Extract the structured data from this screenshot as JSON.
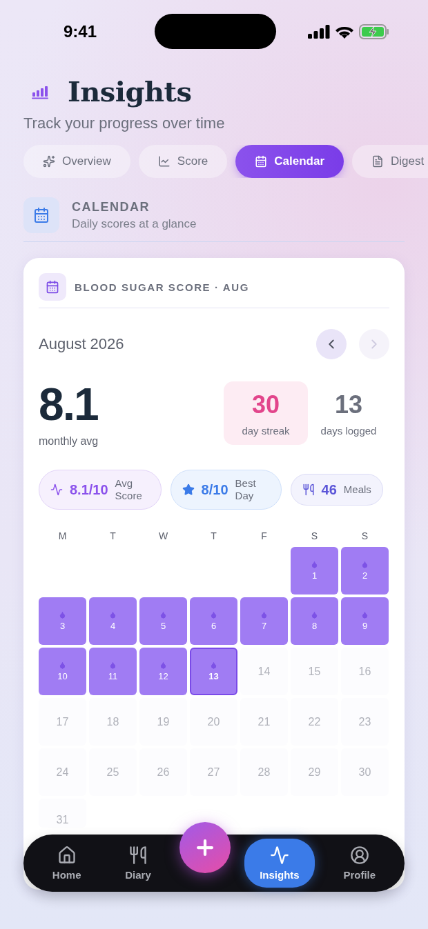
{
  "status_bar": {
    "time": "9:41"
  },
  "header": {
    "title": "Insights",
    "subtitle": "Track your progress over time"
  },
  "tabs": [
    {
      "label": "Overview",
      "selected": false
    },
    {
      "label": "Score",
      "selected": false
    },
    {
      "label": "Calendar",
      "selected": true
    },
    {
      "label": "Digest",
      "selected": false
    }
  ],
  "section": {
    "title": "CALENDAR",
    "subtitle": "Daily scores at a glance"
  },
  "card": {
    "title": "BLOOD SUGAR SCORE · AUG",
    "month": "August 2026",
    "prev_disabled": false,
    "next_disabled": true,
    "monthly_avg": {
      "value": "8.1",
      "label": "monthly avg"
    },
    "streak": {
      "value": "30",
      "label": "day streak"
    },
    "logged": {
      "value": "13",
      "label": "days logged"
    },
    "chips": [
      {
        "kind": "score",
        "value": "8.1/10",
        "label": "Avg Score"
      },
      {
        "kind": "best",
        "value": "8/10",
        "label": "Best Day"
      },
      {
        "kind": "meals",
        "value": "46",
        "label": "Meals"
      }
    ],
    "weekdays": [
      "M",
      "T",
      "W",
      "T",
      "F",
      "S",
      "S"
    ],
    "weeks": [
      [
        {
          "day": "1",
          "logged": true,
          "today": false
        },
        {
          "day": "2",
          "logged": true,
          "today": false
        }
      ],
      [
        {
          "day": "3",
          "logged": true,
          "today": false
        },
        {
          "day": "4",
          "logged": true,
          "today": false
        },
        {
          "day": "5",
          "logged": true,
          "today": false
        },
        {
          "day": "6",
          "logged": true,
          "today": false
        },
        {
          "day": "7",
          "logged": true,
          "today": false
        },
        {
          "day": "8",
          "logged": true,
          "today": false
        },
        {
          "day": "9",
          "logged": true,
          "today": false
        }
      ],
      [
        {
          "day": "10",
          "logged": true,
          "today": false
        },
        {
          "day": "11",
          "logged": true,
          "today": false
        },
        {
          "day": "12",
          "logged": true,
          "today": false
        },
        {
          "day": "13",
          "logged": true,
          "today": true
        },
        {
          "day": "14",
          "logged": false,
          "today": false
        },
        {
          "day": "15",
          "logged": false,
          "today": false
        },
        {
          "day": "16",
          "logged": false,
          "today": false
        }
      ],
      [
        {
          "day": "17",
          "logged": false,
          "today": false
        },
        {
          "day": "18",
          "logged": false,
          "today": false
        },
        {
          "day": "19",
          "logged": false,
          "today": false
        },
        {
          "day": "20",
          "logged": false,
          "today": false
        },
        {
          "day": "21",
          "logged": false,
          "today": false
        },
        {
          "day": "22",
          "logged": false,
          "today": false
        },
        {
          "day": "23",
          "logged": false,
          "today": false
        }
      ],
      [
        {
          "day": "24",
          "logged": false,
          "today": false
        },
        {
          "day": "25",
          "logged": false,
          "today": false
        },
        {
          "day": "26",
          "logged": false,
          "today": false
        },
        {
          "day": "27",
          "logged": false,
          "today": false
        },
        {
          "day": "28",
          "logged": false,
          "today": false
        },
        {
          "day": "29",
          "logged": false,
          "today": false
        },
        {
          "day": "30",
          "logged": false,
          "today": false
        }
      ],
      [
        {
          "day": "31",
          "logged": false,
          "today": false
        }
      ]
    ]
  },
  "bottom_nav": {
    "items": [
      {
        "label": "Home",
        "selected": false
      },
      {
        "label": "Diary",
        "selected": false
      },
      {
        "label": "Insights",
        "selected": true
      },
      {
        "label": "Profile",
        "selected": false
      }
    ]
  }
}
